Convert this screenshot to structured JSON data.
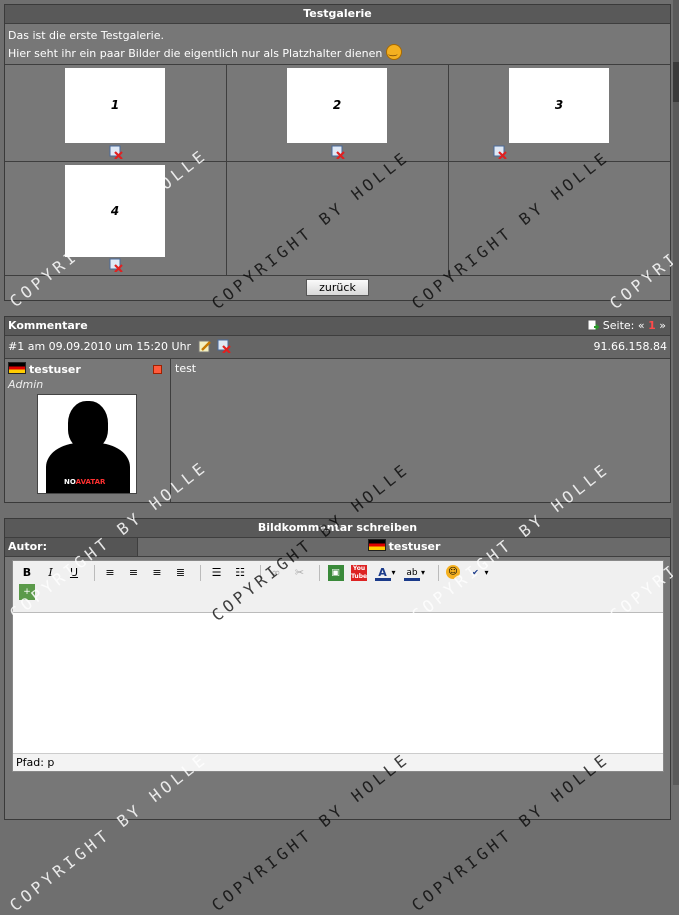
{
  "gallery": {
    "title": "Testgalerie",
    "intro_line1": "Das ist die erste Testgalerie.",
    "intro_line2": "Hier seht ihr ein paar Bilder die eigentlich nur als Platzhalter dienen",
    "thumbnails": [
      "1",
      "2",
      "3",
      "4"
    ],
    "back_button": "zurück"
  },
  "comments": {
    "title": "Kommentare",
    "page_label": "Seite:",
    "page_prev": "«",
    "page_current": "1",
    "page_next": "»",
    "entries": [
      {
        "header": "#1 am 09.09.2010 um 15:20 Uhr",
        "ip": "91.66.158.84",
        "username": "testuser",
        "rank": "Admin",
        "avatar_label_a": "NO",
        "avatar_label_b": "AVATAR",
        "text": "test"
      }
    ]
  },
  "write": {
    "title": "Bildkommentar schreiben",
    "author_label": "Autor:",
    "author_value": "testuser",
    "path_label": "Pfad: p"
  },
  "watermark": "COPYRIGHT BY HOLLE"
}
